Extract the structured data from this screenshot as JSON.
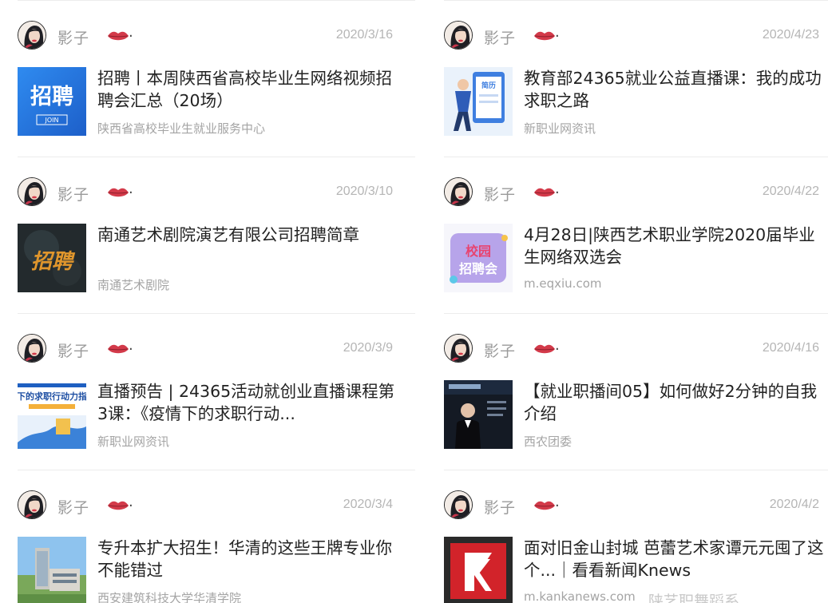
{
  "colors": {
    "title": "#222222",
    "meta": "#9a9a9a",
    "date": "#b5b5b5",
    "lips": "#d33a4a"
  },
  "icons": {
    "avatar": "woman-portrait-avatar",
    "lips": "red-lips-icon"
  },
  "left_column": [
    {
      "author": "影子",
      "suffix": ".",
      "date": "2020/3/16",
      "title": "招聘丨本周陕西省高校毕业生网络视频招聘会汇总（20场）",
      "source": "陕西省高校毕业生就业服务中心",
      "thumb_text": "招聘",
      "thumb_sub": "JOIN"
    },
    {
      "author": "影子",
      "suffix": ".",
      "date": "2020/3/10",
      "title": "南通艺术剧院演艺有限公司招聘简章",
      "source": "南通艺术剧院",
      "thumb_text": "招聘"
    },
    {
      "author": "影子",
      "suffix": ".",
      "date": "2020/3/9",
      "title": "直播预告 | 24365活动就创业直播课程第3课：《疫情下的求职行动...",
      "source": "新职业网资讯",
      "thumb_text": "下的求职行动力指"
    },
    {
      "author": "影子",
      "suffix": ".",
      "date": "2020/3/4",
      "title": "专升本扩大招生！华清的这些王牌专业你不能错过",
      "source": "西安建筑科技大学华清学院"
    }
  ],
  "right_column": [
    {
      "author": "影子",
      "suffix": ".",
      "date": "2020/4/23",
      "title": "教育部24365就业公益直播课：我的成功求职之路",
      "source": "新职业网资讯",
      "thumb_text": "简历"
    },
    {
      "author": "影子",
      "suffix": ".",
      "date": "2020/4/22",
      "title": "4月28日|陕西艺术职业学院2020届毕业生网络双选会",
      "source": "m.eqxiu.com",
      "thumb_text": "校园招聘会"
    },
    {
      "author": "影子",
      "suffix": ".",
      "date": "2020/4/16",
      "title": "【就业职播间05】如何做好2分钟的自我介绍",
      "source": "西农团委"
    },
    {
      "author": "影子",
      "suffix": ".",
      "date": "2020/4/2",
      "title": "面对旧金山封城 芭蕾艺术家谭元元囤了这个...｜看看新闻Knews",
      "source": "m.kankanews.com"
    }
  ],
  "watermark": "陕艺职舞蹈系"
}
